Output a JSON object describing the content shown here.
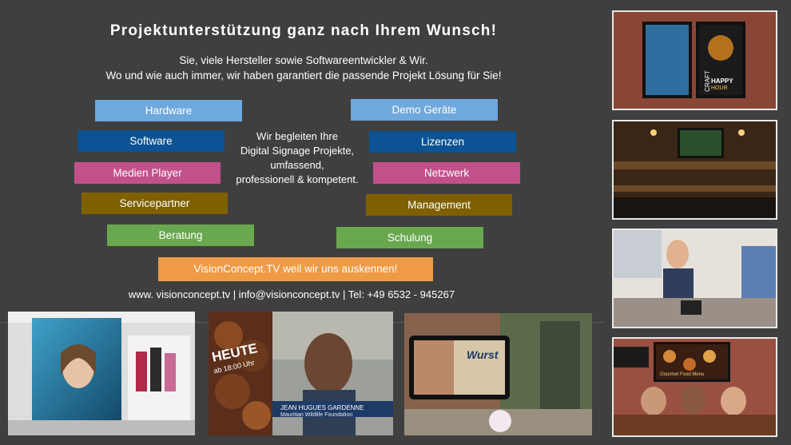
{
  "header": {
    "title": "Projektunterstützung ganz nach Ihrem Wunsch!",
    "subtitle_line1": "Sie, viele Hersteller sowie Softwareentwickler & Wir.",
    "subtitle_line2": "Wo und wie auch immer, wir haben garantiert die passende Projekt Lösung für Sie!"
  },
  "left_tags": [
    {
      "label": "Hardware",
      "color": "#6fa8dc"
    },
    {
      "label": "Software",
      "color": "#0b5394"
    },
    {
      "label": "Medien Player",
      "color": "#c2508b"
    },
    {
      "label": "Servicepartner",
      "color": "#7f6000"
    },
    {
      "label": "Beratung",
      "color": "#6aa84f"
    }
  ],
  "right_tags": [
    {
      "label": "Demo Geräte",
      "color": "#6fa8dc"
    },
    {
      "label": "Lizenzen",
      "color": "#0b5394"
    },
    {
      "label": "Netzwerk",
      "color": "#c2508b"
    },
    {
      "label": "Management",
      "color": "#7f6000"
    },
    {
      "label": "Schulung",
      "color": "#6aa84f"
    }
  ],
  "center": {
    "line1": "Wir begleiten Ihre",
    "line2": "Digital Signage Projekte,",
    "line3": "umfassend,",
    "line4": "professionell & kompetent."
  },
  "cta": {
    "label": "VisionConcept.TV weil wir uns auskennen!",
    "color": "#ef9a45"
  },
  "contact": {
    "text": "www. visionconcept.tv | info@visionconcept.tv | Tel: +49 6532 - 945267"
  },
  "photos": {
    "heute_text": "HEUTE",
    "heute_sub": "ab 18:00 Uhr",
    "name_caption": "JEAN HUGUES GARDENNE",
    "name_sub": "Mauritian Wildlife Foundation",
    "wurst_text": "Wurst",
    "craft_text": "CRAFT",
    "happy_text": "HAPPY",
    "hour_text": "HOUR",
    "menu_text": "Gourmet Food Menu"
  }
}
